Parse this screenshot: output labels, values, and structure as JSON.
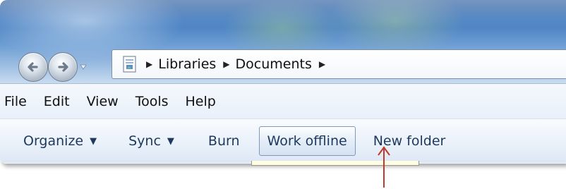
{
  "address_bar": {
    "crumbs": [
      "Libraries",
      "Documents"
    ]
  },
  "menu_bar": {
    "items": [
      "File",
      "Edit",
      "View",
      "Tools",
      "Help"
    ]
  },
  "toolbar": {
    "organize_label": "Organize",
    "sync_label": "Sync",
    "burn_label": "Burn",
    "work_offline_label": "Work offline",
    "new_folder_label": "New folder"
  },
  "icons": {
    "back": "back-arrow-icon",
    "forward": "forward-arrow-icon",
    "recent": "recent-pages-dropdown-icon",
    "address": "folder-location-icon",
    "breadcrumb_separator": "chevron-right-icon",
    "dropdown": "caret-down-icon",
    "annotation": "red-pointer-arrow-icon"
  },
  "colors": {
    "annotation_arrow": "#c0392b",
    "toolbar_text": "#1e395b"
  }
}
